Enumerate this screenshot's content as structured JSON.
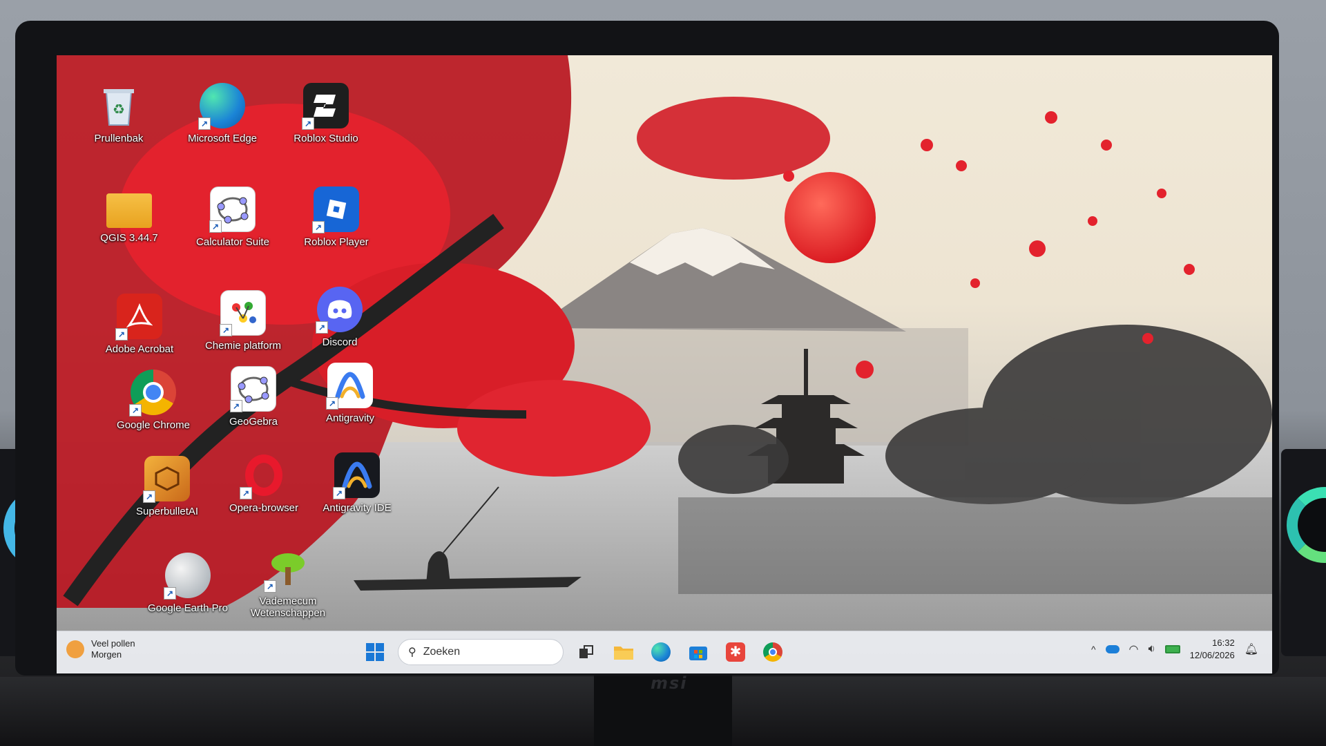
{
  "desktop": {
    "icons": [
      {
        "label": "Prullenbak",
        "icon": "recycle-bin-icon"
      },
      {
        "label": "Microsoft Edge",
        "icon": "edge-icon"
      },
      {
        "label": "Roblox Studio",
        "icon": "roblox-studio-icon"
      },
      {
        "label": "QGIS 3.44.7",
        "icon": "qgis-folder-icon"
      },
      {
        "label": "Calculator Suite",
        "icon": "geogebra-calculator-icon"
      },
      {
        "label": "Roblox Player",
        "icon": "roblox-player-icon"
      },
      {
        "label": "Adobe Acrobat",
        "icon": "adobe-acrobat-icon"
      },
      {
        "label": "Chemie platform",
        "icon": "chemie-platform-icon"
      },
      {
        "label": "Discord",
        "icon": "discord-icon"
      },
      {
        "label": "Google Chrome",
        "icon": "chrome-icon"
      },
      {
        "label": "GeoGebra",
        "icon": "geogebra-icon"
      },
      {
        "label": "Antigravity",
        "icon": "antigravity-icon"
      },
      {
        "label": "SuperbulletAI",
        "icon": "superbullet-icon"
      },
      {
        "label": "Opera-browser",
        "icon": "opera-icon"
      },
      {
        "label": "Antigravity IDE",
        "icon": "antigravity-ide-icon"
      },
      {
        "label": "Google Earth Pro",
        "icon": "google-earth-icon"
      },
      {
        "label": "Vademecum Wetenschappen",
        "icon": "vademecum-icon"
      }
    ]
  },
  "taskbar": {
    "weather_line1": "Veel pollen",
    "weather_line2": "Morgen",
    "search_placeholder": "Zoeken",
    "pinned": [
      "task-view-icon",
      "file-explorer-icon",
      "edge-icon",
      "microsoft-store-icon",
      "snipping-tool-icon",
      "chrome-icon"
    ],
    "tray_chevron": "^",
    "time": "16:32",
    "date": "12/06/2026"
  },
  "monitor": {
    "brand": "msi"
  },
  "colors": {
    "accent_red": "#e3222d",
    "sun": "#ee2a2a",
    "taskbar": "#eceef2"
  }
}
